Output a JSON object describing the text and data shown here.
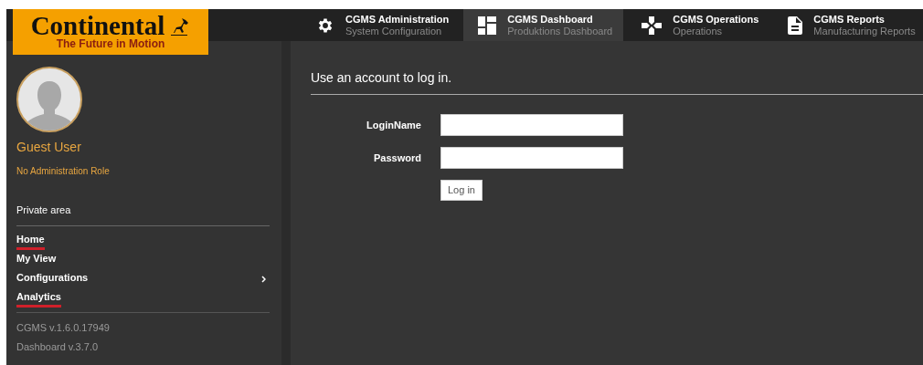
{
  "logo": {
    "name": "Continental",
    "tagline": "The Future in Motion"
  },
  "tabs": [
    {
      "kind": "gear",
      "title": "CGMS Administration",
      "subtitle": "System Configuration",
      "selected": false
    },
    {
      "kind": "dashboard",
      "title": "CGMS Dashboard",
      "subtitle": "Produktions Dashboard",
      "selected": true
    },
    {
      "kind": "operations",
      "title": "CGMS Operations",
      "subtitle": "Operations",
      "selected": false
    },
    {
      "kind": "report",
      "title": "CGMS Reports",
      "subtitle": "Manufacturing Reports",
      "selected": false
    }
  ],
  "user": {
    "name": "Guest User",
    "role": "No Administration Role"
  },
  "sidebar": {
    "section": "Private area",
    "items": [
      {
        "label": "Home",
        "has_submenu": false,
        "underlined": true
      },
      {
        "label": "My View",
        "has_submenu": false,
        "underlined": false
      },
      {
        "label": "Configurations",
        "has_submenu": true,
        "underlined": false
      },
      {
        "label": "Analytics",
        "has_submenu": false,
        "underlined": true
      }
    ],
    "versions": [
      "CGMS v.1.6.0.17949",
      "Dashboard v.3.7.0"
    ]
  },
  "login": {
    "heading": "Use an account to log in.",
    "fields": [
      {
        "label": "LoginName"
      },
      {
        "label": "Password"
      }
    ],
    "button": "Log in"
  }
}
